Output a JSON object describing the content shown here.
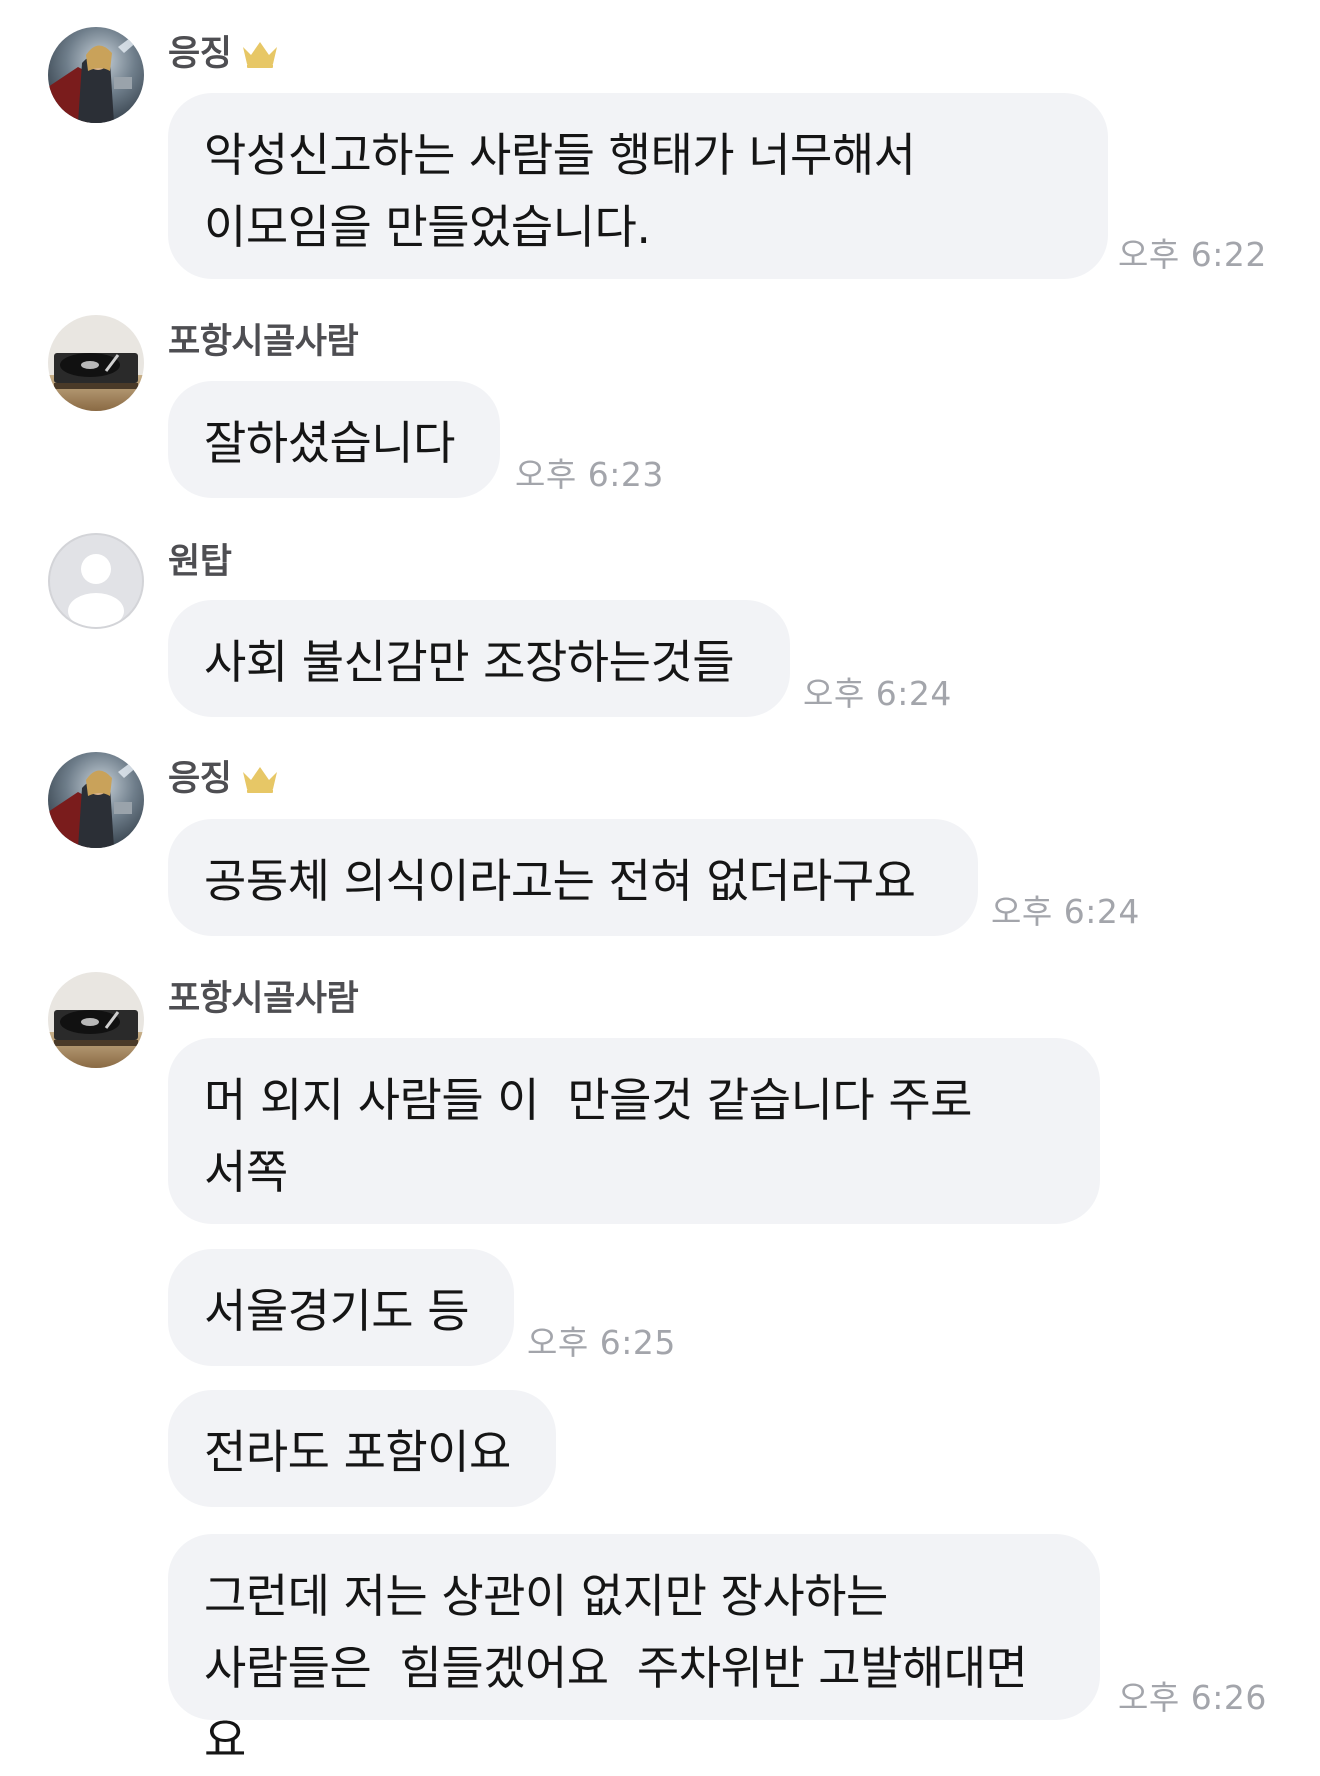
{
  "messages": [
    {
      "sender": "응징",
      "is_owner": true,
      "text": "악성신고하는 사람들 행태가 너무해서 이모임을 만들었습니다.",
      "time": "오후 6:22"
    },
    {
      "sender": "포항시골사람",
      "text": "잘하셨습니다",
      "time": "오후 6:23"
    },
    {
      "sender": "원탑",
      "text": "사회 불신감만 조장하는것들",
      "time": "오후 6:24"
    },
    {
      "sender": "응징",
      "is_owner": true,
      "text": "공동체 의식이라고는 전혀 없더라구요",
      "time": "오후 6:24"
    },
    {
      "sender": "포항시골사람",
      "text": "머 외지 사람들 이  만을것 같습니다 주로 서쪽"
    },
    {
      "text": "서울경기도 등",
      "time": "오후 6:25"
    },
    {
      "text": "전라도 포함이요"
    },
    {
      "text": "그런데 저는 상관이 없지만 장사하는 사람들은  힘들겠어요  주차위반 고발해대면 요",
      "time": "오후 6:26"
    }
  ],
  "icons": {
    "owner_badge": "crown-icon",
    "default_avatar": "user-placeholder-icon"
  },
  "colors": {
    "bubble": "#f2f3f6",
    "name": "#4e4e52",
    "time": "#a3a5ab",
    "crown": "#e7c766"
  }
}
